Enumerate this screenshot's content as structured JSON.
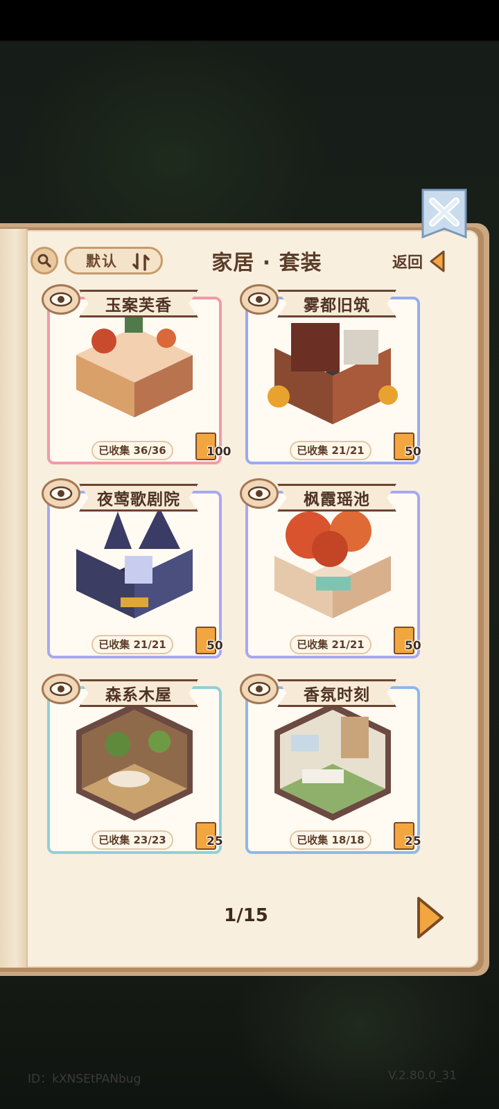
{
  "header": {
    "sort_label": "默认",
    "title": "家居 · 套装",
    "back_label": "返回"
  },
  "cards": [
    {
      "name": "玉案芙香",
      "collected": "已收集 36/36",
      "reward": "100",
      "frame_color": "#f29aa8"
    },
    {
      "name": "雾都旧筑",
      "collected": "已收集 21/21",
      "reward": "50",
      "frame_color": "#9aaaf0"
    },
    {
      "name": "夜莺歌剧院",
      "collected": "已收集 21/21",
      "reward": "50",
      "frame_color": "#a8a8f0"
    },
    {
      "name": "枫霞瑶池",
      "collected": "已收集 21/21",
      "reward": "50",
      "frame_color": "#a8a8f0"
    },
    {
      "name": "森系木屋",
      "collected": "已收集 23/23",
      "reward": "25",
      "frame_color": "#8fd0d8"
    },
    {
      "name": "香氛时刻",
      "collected": "已收集 18/18",
      "reward": "25",
      "frame_color": "#8fb8e8"
    }
  ],
  "pager": {
    "text": "1/15"
  },
  "footer": {
    "id": "ID：kXNSEtPANbug",
    "version": "V.2.80.0_31"
  }
}
